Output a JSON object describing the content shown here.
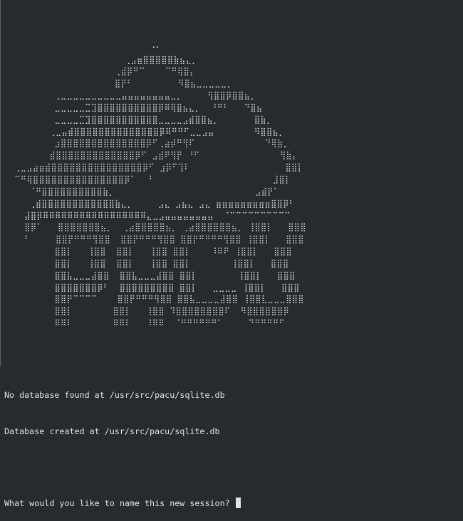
{
  "terminal": {
    "banner_art": [
      "                             ⠐⠂",
      "                        ⢀⣠⣶⣿⣿⣿⣿⣿⣷⣦⣄⡀",
      "                      ⢀⣾⡿⠛⠉    ⠉⠛⢿⣿⡄",
      "                      ⣿⡟⠃         ⠻⣿⣦⣀⣀⣀⣀⣀⡀",
      "          ⢀⣀⣀⣀⣀⣀⣀⣀⣀⣀⣀⣤⣤⣤⣤⣤⣤⣤⣤⣀⡀     ⢻⣿⣿⡿⣿⣿⣦⡀",
      "          ⣀⣀⣀⣀⣀⣉⣹⣿⣿⣿⣿⣿⣿⣿⣿⣿⣿⡿⠿⢿⣿⣦⣄⡀  ⠘⠛⠃   ⠙⣿⣦",
      "          ⣀⣀⣀⣀⣉⣹⣿⣿⣿⣿⣿⣿⣿⣿⣿⣿⣿⣀⣀⣀⣀⣠⣾⣿⣿⣦⡀       ⣿⣷⡀",
      "         ⢀⣀⣤⣾⣿⣿⣿⣿⣿⣿⣿⣿⣿⣿⣿⣿⣿⣿⡿⠿⠛⠛⠋⣀⣀⣠⣤        ⠻⣿⣿⣦⡀",
      "          ⣰⣿⣿⣿⣿⣿⣿⣿⣿⣿⣿⣿⣿⣿⣿⡿⠋⢀⣴⡾⠛⢻⠏              ⠙⢿⣷⡀",
      "         ⣾⣿⣿⣿⣿⣿⣿⣿⣿⣿⣿⣿⣿⣿⡿⠋ ⣠⣾⠟⢻⡟ ⠘⠋                ⢻⣷⡄",
      "  ⢀⣀⣠⣴⣶⣾⣿⣿⣿⣿⣿⣿⣿⣿⣿⣿⣿⣿⣿⣿⣿⡿⠋ ⣰⡿⠋⢹⠇                   ⣿⣿⡇",
      "  ⠉⠛⢿⣿⣿⣿⣿⣿⣿⣿⣿⣿⣿⣿⣿⣿⣿⣿⡿⠁  ⠘                        ⣸⣿⡇",
      "     ⠈⠛⣿⣿⣿⣿⣿⣿⣿⣿⣿⣿⣷⡀                            ⣠⣾⡟⠁",
      "     ⢀⣾⣿⣿⣿⣿⣿⣿⣿⣿⣿⣿⣿⣿⣷⣄⡀     ⣠⣄ ⣠⣦⣄ ⣠⣄ ⣶⣶⣶⣶⣶⣶⣶⣶⣶⣿⣿⡿⠃",
      "    ⣼⣿⡿⠿⠿⠿⠿⠿⠿⠿⠿⠿⠿⠿⠿⠿⠿⠿⠿⠿⣄⣀⣠⣤⣤⣤⣤⣤⣤⣤⣤  ⠈⠉⠉⠉⠉⠉⠉⠉⠉⠉⠉",
      "    ⣿⡿⠁   ⣿⣿⣿⣿⣿⣿⣿⣦⡀  ⢀⣴⣿⣿⣿⣿⣿⣦⡀ ⢀⣴⣿⣿⣿⣿⣿⣿⣦⡀ ⢸⣿⣿⡇   ⣿⣿⣿",
      "    ⠃     ⣿⣿⡟⠛⠛⠛⢻⣿⣿  ⣿⣿⡟⠛⠛⠛⢻⣿⣿ ⣿⣿⡟⠛⠛⠛⠛⢻⣿⣿ ⢸⣿⣿⡇   ⣿⣿⣿",
      "          ⣿⣿⡇   ⢸⣿⣿  ⣿⣿⡇   ⢸⣿⣿ ⣿⣿⡇    ⠸⠿⠟ ⢸⣿⣿⡇   ⣿⣿⣿",
      "          ⣿⣿⡇   ⢸⣿⣿  ⣿⣿⡇   ⢸⣿⣿ ⣿⣿⡇        ⢸⣿⣿⡇   ⣿⣿⣿",
      "          ⣿⣿⣧⣀⣀⣀⣼⣿⣿  ⣿⣿⣧⣀⣀⣀⣼⣿⣿ ⣿⣿⡇        ⢸⣿⣿⡇   ⣿⣿⣿",
      "          ⣿⣿⣿⣿⣿⣿⣿⡿⠃  ⣿⣿⣿⣿⣿⣿⣿⣿⣿ ⣿⣿⡇   ⣀⣀⣀⣀ ⢸⣿⣿⡇   ⣿⣿⣿",
      "          ⣿⣿⡟⠉⠉⠉⠉    ⣿⣿⡟⠛⠛⠛⢻⣿⣿ ⣿⣿⣧⣀⣀⣀⣀⣼⣿⣿ ⢸⣿⣿⣇⣀⣀⣀⣿⣿⣿",
      "          ⣿⣿⡇        ⣿⣿⡇   ⢸⣿⣿ ⠹⣿⣿⣿⣿⣿⣿⣿⣿⠏  ⠻⣿⣿⣿⣿⣿⣿⡿",
      "          ⠿⠿⠇        ⠿⠿⠇   ⠸⠿⠿  ⠈⠛⠛⠛⠛⠛⠛⠁     ⠙⠛⠛⠛⠛⠋"
    ],
    "banner_text": "PACU",
    "messages": [
      "No database found at /usr/src/pacu/sqlite.db",
      "Database created at /usr/src/pacu/sqlite.db"
    ],
    "prompt": "What would you like to name this new session? ",
    "input_value": ""
  },
  "colors": {
    "background": "#262b30",
    "text": "#e3e3e3"
  }
}
